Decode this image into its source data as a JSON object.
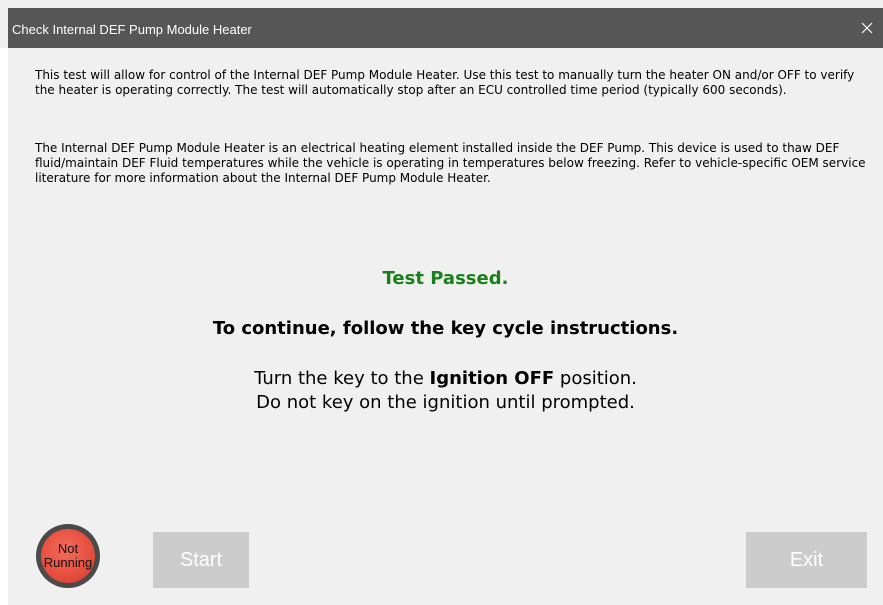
{
  "window": {
    "title": "Check Internal DEF Pump Module Heater",
    "close_glyph": "✕"
  },
  "description": {
    "paragraph1": "This test will allow for control of the Internal DEF Pump Module Heater. Use this test to manually turn the heater ON and/or OFF to verify the heater is operating correctly. The test will automatically stop after an ECU controlled time period (typically 600 seconds).",
    "paragraph2": "The Internal DEF Pump Module Heater is an electrical heating element installed inside the DEF Pump. This device is used to thaw DEF fluid/maintain DEF Fluid temperatures while the vehicle is operating in temperatures below freezing. Refer to vehicle-specific OEM service literature for more information about the Internal DEF Pump Module Heater."
  },
  "result": {
    "status": "Test Passed.",
    "continue_text": "To continue, follow the key cycle instructions."
  },
  "instructions": {
    "line1_prefix": "Turn the key to the ",
    "line1_bold": "Ignition OFF",
    "line1_suffix": " position.",
    "line2": "Do not key on the ignition until prompted."
  },
  "status_indicator": {
    "line1": "Not",
    "line2": "Running"
  },
  "buttons": {
    "start": "Start",
    "exit": "Exit"
  },
  "colors": {
    "title_bar": "#565656",
    "passed_text": "#1a7f1a",
    "indicator_red": "#e8503f",
    "disabled_button": "#cccccc"
  }
}
